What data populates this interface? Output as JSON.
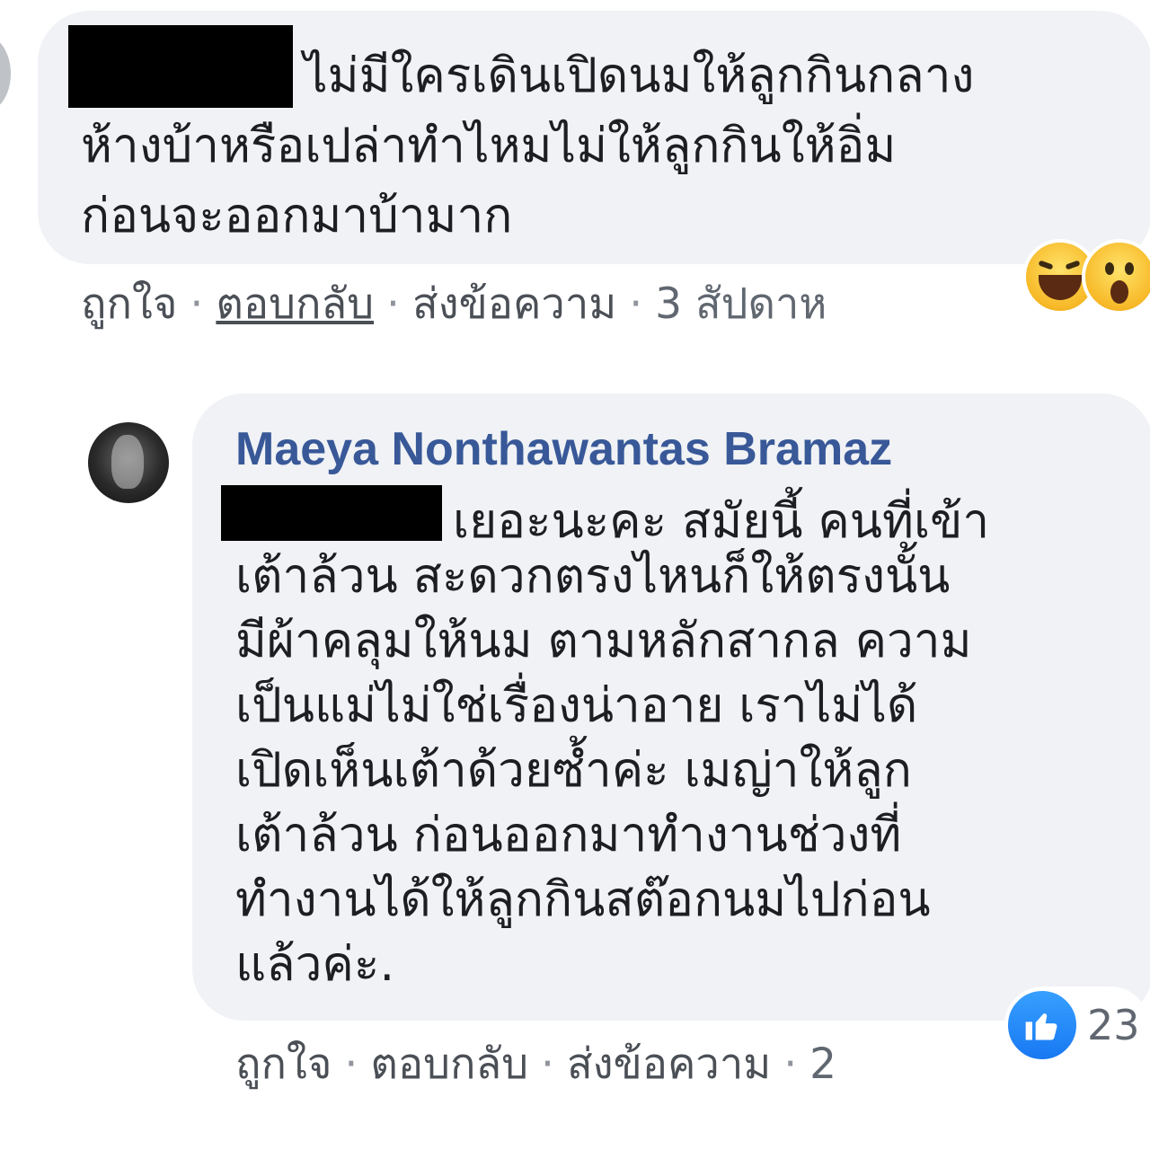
{
  "comment1": {
    "text_line1": "ไม่มีใครเดินเปิดนมให้ลูกกินกลาง",
    "text_rest": "ห้างบ้าหรือเปล่าทำไหมไม่ให้ลูกกินให้อิ่ม\nก่อนจะออกมาบ้ามาก",
    "actions": {
      "like": "ถูกใจ",
      "reply": "ตอบกลับ",
      "message": "ส่งข้อความ",
      "time": "3 สัปดาห"
    },
    "reactions": [
      "haha-icon",
      "wow-icon"
    ]
  },
  "comment2": {
    "author": "Maeya Nonthawantas Bramaz",
    "text_line1": "เยอะนะคะ สมัยนี้ คนที่เข้า",
    "text_rest": "เต้าล้วน สะดวกตรงไหนก็ให้ตรงนั้น\nมีผ้าคลุมให้นม ตามหลักสากล ความ\nเป็นแม่ไม่ใช่เรื่องน่าอาย เราไม่ได้\nเปิดเห็นเต้าด้วยซ้ำค่ะ เมญ่าให้ลูก\nเต้าล้วน ก่อนออกมาทำงานช่วงที่\nทำงานได้ให้ลูกกินสต๊อกนมไปก่อน\nแล้วค่ะ.",
    "actions": {
      "like": "ถูกใจ",
      "reply": "ตอบกลับ",
      "message": "ส่งข้อความ",
      "time": "2"
    },
    "like_count": "23"
  },
  "separator": "·",
  "colors": {
    "bubble": "#f0f2f5",
    "author": "#385898",
    "meta": "#606770",
    "like_blue": "#1878f2"
  }
}
